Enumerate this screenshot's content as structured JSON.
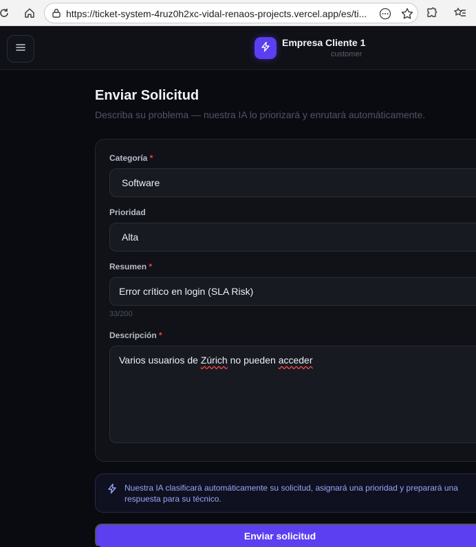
{
  "browser": {
    "url": "https://ticket-system-4ruz0h2xc-vidal-renaos-projects.vercel.app/es/ti..."
  },
  "header": {
    "company_name": "Empresa Cliente 1",
    "role": "customer"
  },
  "page": {
    "title": "Enviar Solicitud",
    "subtitle": "Describa su problema — nuestra IA lo priorizará y enrutará automáticamente."
  },
  "form": {
    "category": {
      "label": "Categoría",
      "required_mark": "*",
      "value": "Software"
    },
    "priority": {
      "label": "Prioridad",
      "value": "Alta"
    },
    "summary": {
      "label": "Resumen",
      "required_mark": "*",
      "value": "Error crítico en login (SLA Risk)",
      "counter": "33/200"
    },
    "description": {
      "label": "Descripción",
      "required_mark": "*",
      "value_parts": [
        "Varios usuarios de ",
        "Zúrich",
        " no pueden ",
        "acceder"
      ]
    }
  },
  "info": {
    "line1": "Nuestra IA clasificará automáticamente su solicitud, asignará una prioridad y preparará una",
    "line2": "respuesta para su técnico."
  },
  "submit_label": "Enviar solicitud",
  "colors": {
    "accent": "#5b3ff0",
    "required": "#ef4444",
    "info_text": "#9aa7f5",
    "background": "#0a0b10"
  },
  "icons": [
    "reload-icon",
    "home-icon",
    "site-info-icon",
    "more-icon",
    "star-icon",
    "extensions-icon",
    "favorites-icon",
    "menu-icon",
    "bolt-icon"
  ]
}
